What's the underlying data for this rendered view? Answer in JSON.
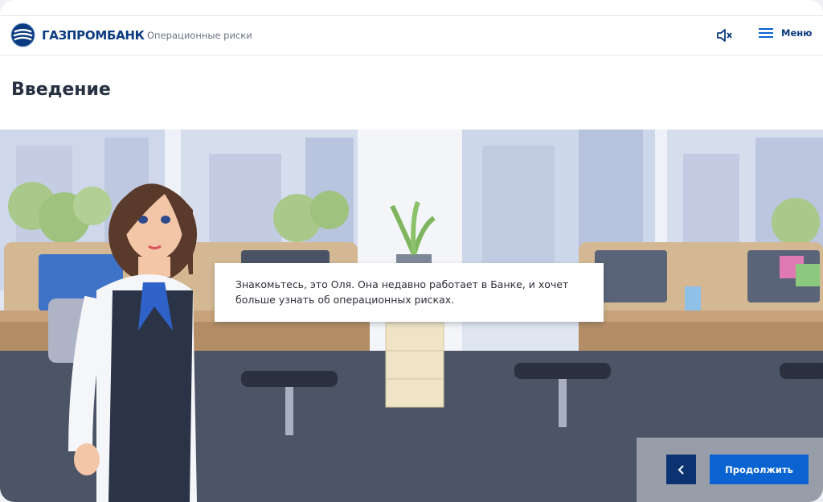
{
  "header": {
    "logo_text": "ГАЗПРОМБАНК",
    "course_title": "Операционные риски",
    "menu_label": "Меню",
    "mute_icon": "speaker-muted-icon",
    "menu_icon": "hamburger-icon"
  },
  "page": {
    "title": "Введение"
  },
  "dialog": {
    "text": "Знакомьтесь, это Оля. Она недавно работает в Банке, и хочет больше узнать об операционных рисках."
  },
  "navigation": {
    "back_icon": "chevron-left-icon",
    "continue_label": "Продолжить"
  },
  "colors": {
    "brand": "#0a3a80",
    "primary_button": "#0a63d1",
    "back_button": "#0c3272"
  }
}
